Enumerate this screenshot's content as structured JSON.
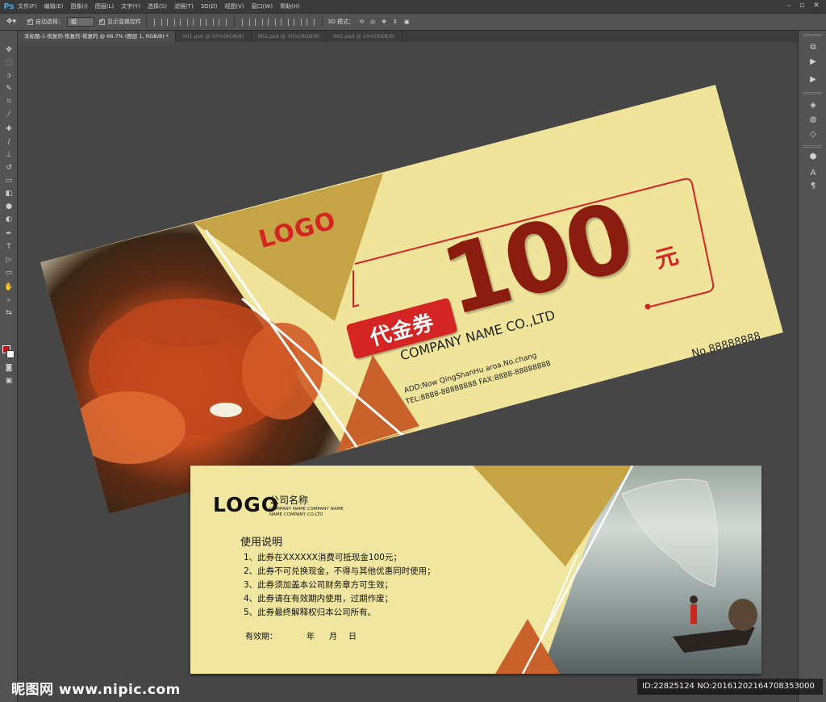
{
  "app": {
    "logo": "Ps"
  },
  "menu": {
    "items": [
      "文件(F)",
      "编辑(E)",
      "图像(I)",
      "图层(L)",
      "文字(Y)",
      "选择(S)",
      "滤镜(T)",
      "3D(D)",
      "视图(V)",
      "窗口(W)",
      "帮助(H)"
    ]
  },
  "options": {
    "auto_select_label": "自动选择：",
    "auto_select_value": "组",
    "show_transform_label": "显示变换控件",
    "mode_3d_label": "3D 模式："
  },
  "tabs": [
    {
      "label": "未标题-1-恢复的-恢复的-恢复的 @ 66.7% (图层 1, RGB/8) *",
      "active": true
    },
    {
      "label": "001.psd @ 50%(RGB/8)",
      "active": false
    },
    {
      "label": "002.psd @ 50%(RGB/8)",
      "active": false
    },
    {
      "label": "002.psd @ 25%(RGB/8)",
      "active": false
    }
  ],
  "colors": {
    "voucher_bg": "#f0e49b",
    "accent_red": "#8b1c10",
    "badge_red": "#d42424",
    "tri_gold": "#c6a445",
    "tri_orange": "#c9612a",
    "foreground_swatch": "#cc1111",
    "background_swatch": "#ffffff"
  },
  "front": {
    "logo": "LOGO",
    "amount": "100",
    "unit": "元",
    "badge": "代金券",
    "company": "COMPANY NAME CO.,LTD",
    "address": "ADD:Now QingShanHu aroa.No.chang",
    "tel_fax": "TEL:8888-88888888   FAX:8888-88888888",
    "serial": "No.88888888"
  },
  "back": {
    "logo": "LOGO",
    "company_cn": "公司名称",
    "company_en_1": "COMPANY NAME COMPANY NAME",
    "company_en_2": "NAME COMPANY CO.LTD",
    "instructions_title": "使用说明",
    "lines": [
      "1、此券在XXXXXX消费可抵现金100元；",
      "2、此券不可兑换现金，不得与其他优惠同时使用；",
      "3、此券须加盖本公司财务章方可生效；",
      "4、此券请在有效期内使用，过期作废；",
      "5、此券最终解释权归本公司所有。"
    ],
    "valid_label": "有效期：",
    "year": "年",
    "month": "月",
    "day": "日"
  },
  "watermark": {
    "site": "昵图网 www.nipic.com",
    "id": "ID:22825124 NO:20161202164708353000"
  }
}
